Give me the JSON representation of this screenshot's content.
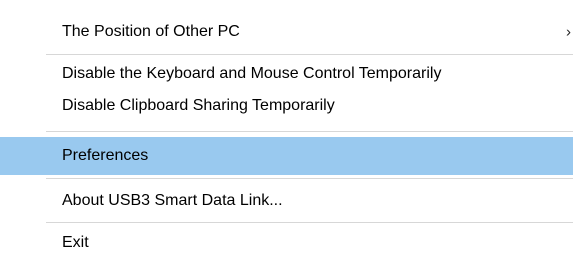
{
  "menu": {
    "items": [
      {
        "label": "The Position of Other PC",
        "submenu_glyph": "›",
        "highlighted": false
      },
      {
        "label": "Disable the Keyboard and Mouse Control Temporarily",
        "highlighted": false
      },
      {
        "label": "Disable Clipboard Sharing Temporarily",
        "highlighted": false
      },
      {
        "label": "Preferences",
        "highlighted": true
      },
      {
        "label": "About USB3 Smart Data Link...",
        "highlighted": false
      },
      {
        "label": "Exit",
        "highlighted": false
      }
    ],
    "highlight_color": "#99c9ef",
    "separator_color": "#d7d7d7",
    "submenu_icon": "chevron-right-icon"
  }
}
